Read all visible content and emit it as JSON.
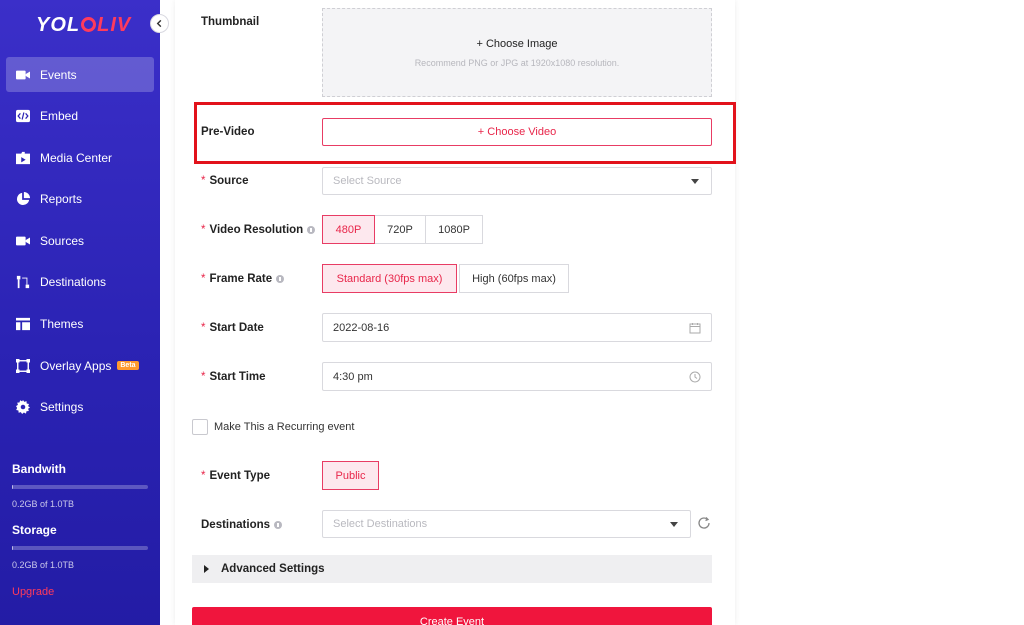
{
  "sidebar": {
    "logo": {
      "part1": "YOL",
      "part2": "LIV"
    },
    "items": [
      {
        "label": "Events",
        "icon": "video-camera-icon",
        "active": true
      },
      {
        "label": "Embed",
        "icon": "code-icon"
      },
      {
        "label": "Media Center",
        "icon": "media-folder-icon"
      },
      {
        "label": "Reports",
        "icon": "pie-chart-icon"
      },
      {
        "label": "Sources",
        "icon": "camera-icon"
      },
      {
        "label": "Destinations",
        "icon": "branch-icon"
      },
      {
        "label": "Themes",
        "icon": "layout-icon"
      },
      {
        "label": "Overlay Apps",
        "icon": "overlay-icon",
        "badge": "Beta"
      },
      {
        "label": "Settings",
        "icon": "gear-icon"
      }
    ],
    "bandwidth": {
      "title": "Bandwith",
      "text": "0.2GB of 1.0TB",
      "fraction": 0.0002
    },
    "storage": {
      "title": "Storage",
      "text": "0.2GB of 1.0TB",
      "fraction": 0.0002
    },
    "upgrade": "Upgrade"
  },
  "form": {
    "thumbnail": {
      "label": "Thumbnail",
      "button": "+ Choose Image",
      "hint": "Recommend PNG or JPG at 1920x1080 resolution."
    },
    "pre_video": {
      "label": "Pre-Video",
      "button": "+ Choose Video"
    },
    "source": {
      "label": "Source",
      "placeholder": "Select Source"
    },
    "video_resolution": {
      "label": "Video Resolution",
      "options": [
        "480P",
        "720P",
        "1080P"
      ],
      "selected": "480P"
    },
    "frame_rate": {
      "label": "Frame Rate",
      "options": [
        "Standard (30fps max)",
        "High (60fps max)"
      ],
      "selected": "Standard (30fps max)"
    },
    "start_date": {
      "label": "Start Date",
      "value": "2022-08-16"
    },
    "start_time": {
      "label": "Start Time",
      "value": "4:30 pm"
    },
    "recurring": {
      "label": "Make This a Recurring event",
      "checked": false
    },
    "event_type": {
      "label": "Event Type",
      "value": "Public"
    },
    "destinations": {
      "label": "Destinations",
      "placeholder": "Select Destinations"
    },
    "advanced": "Advanced Settings",
    "submit": "Create Event"
  },
  "colors": {
    "accent": "#e8264a",
    "sidebar": "#2b23b4",
    "highlight": "#e2121b"
  }
}
